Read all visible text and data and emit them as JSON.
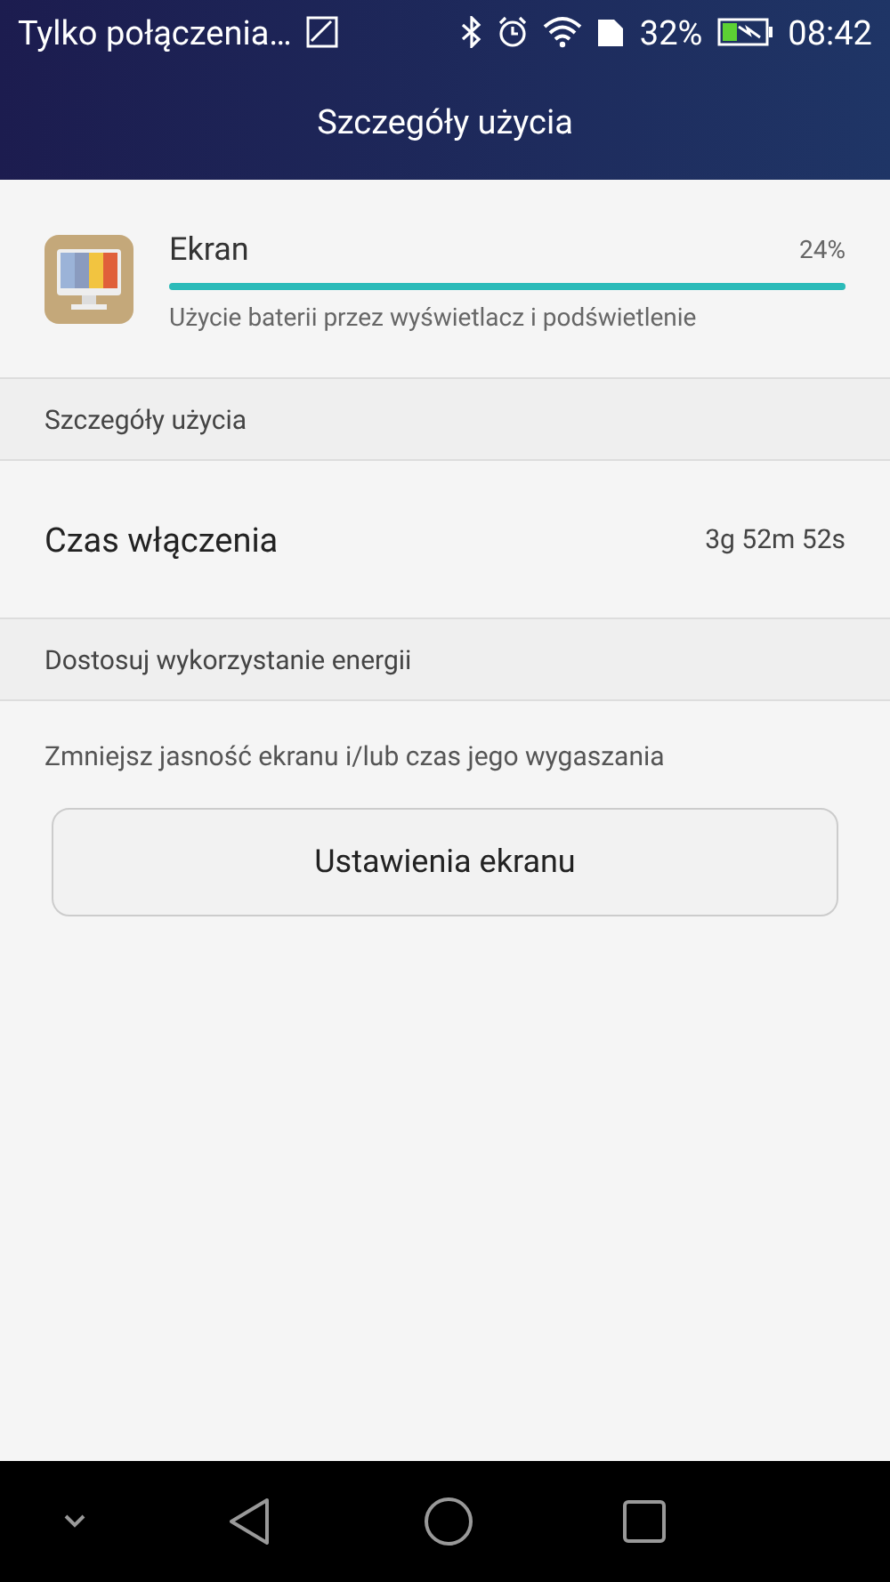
{
  "status_bar": {
    "carrier": "Tylko połączenia…",
    "battery_percent": "32%",
    "time": "08:42"
  },
  "header": {
    "title": "Szczegóły użycia"
  },
  "app": {
    "name": "Ekran",
    "percent": "24%",
    "level": 1.0,
    "description": "Użycie baterii przez wyświetlacz i podświetlenie"
  },
  "sections": [
    {
      "title": "Szczegóły użycia",
      "rows": [
        {
          "label": "Czas włączenia",
          "value": "3g 52m 52s"
        }
      ]
    },
    {
      "title": "Dostosuj wykorzystanie energii",
      "hint": "Zmniejsz jasność ekranu i/lub czas jego wygaszania",
      "button": "Ustawienia ekranu"
    }
  ]
}
